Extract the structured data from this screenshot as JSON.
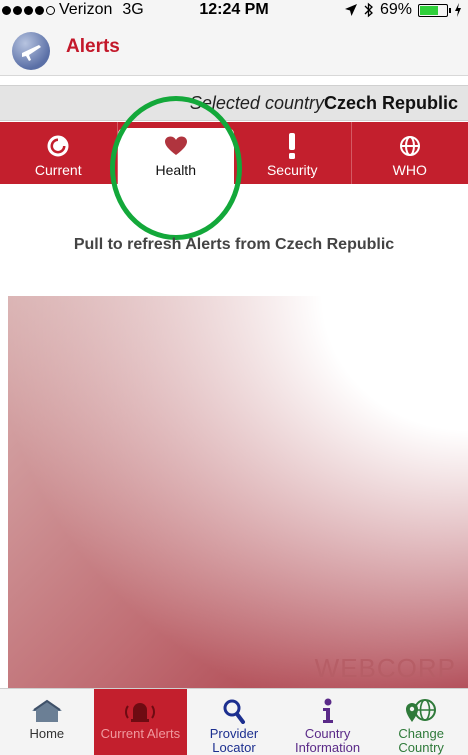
{
  "status_bar": {
    "carrier": "Verizon",
    "network": "3G",
    "time": "12:24 PM",
    "battery": "69%",
    "battery_level": 0.69
  },
  "nav": {
    "title": "Alerts",
    "logo_icon": "plane-globe-icon"
  },
  "country_bar": {
    "label": "Selected country",
    "value": "Czech Republic"
  },
  "tabs": [
    {
      "label": "Current",
      "icon": "clock-icon",
      "active": false
    },
    {
      "label": "Health",
      "icon": "heart-icon",
      "active": true
    },
    {
      "label": "Security",
      "icon": "exclamation-icon",
      "active": false
    },
    {
      "label": "WHO",
      "icon": "globe-icon",
      "active": false
    }
  ],
  "content": {
    "refresh_text": "Pull to refresh Alerts from Czech Republic",
    "watermark": "WEBCORP"
  },
  "bottom_tabs": [
    {
      "label": "Home",
      "icon": "home-icon",
      "active": false
    },
    {
      "label": "Current Alerts",
      "icon": "alarm-bell-icon",
      "active": true
    },
    {
      "label": "Provider Locator",
      "icon": "magnifier-icon",
      "active": false
    },
    {
      "label": "Country Information",
      "icon": "info-icon",
      "active": false
    },
    {
      "label": "Change Country",
      "icon": "globe-pin-icon",
      "active": false
    }
  ],
  "colors": {
    "accent_red": "#c31f2d",
    "highlight_green": "#13a83a"
  }
}
